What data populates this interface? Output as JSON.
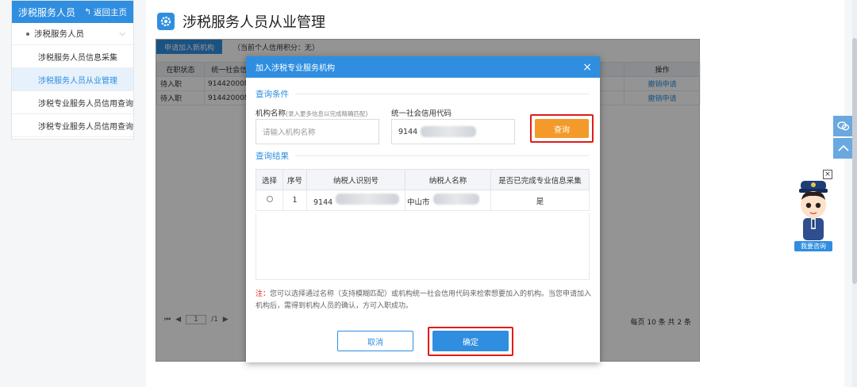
{
  "sidebar": {
    "title": "涉税服务人员",
    "back_label": "返回主页",
    "group_label": "涉税服务人员",
    "items": [
      {
        "label": "涉税服务人员信息采集",
        "active": false
      },
      {
        "label": "涉税服务人员从业管理",
        "active": true
      },
      {
        "label": "涉税专业服务人员信用查询",
        "active": false
      },
      {
        "label": "涉税专业服务人员信用查询",
        "active": false
      }
    ]
  },
  "main": {
    "page_title": "涉税服务人员从业管理",
    "apply_button": "申请加入新机构",
    "credit_text": "（当前个人信用积分：无）",
    "table": {
      "headers": [
        "在职状态",
        "统一社会信",
        "",
        "",
        "",
        "",
        "",
        "操作"
      ],
      "rows": [
        {
          "status": "待入职",
          "code": "91442000M",
          "action": "撤销申请"
        },
        {
          "status": "待入职",
          "code": "91442000M",
          "action": "撤销申请"
        }
      ]
    },
    "pager": {
      "first": "⏮",
      "prev": "◀",
      "page": "1",
      "total": "/1",
      "next": "▶",
      "summary": "每页 10 条 共 2 条"
    }
  },
  "modal": {
    "title": "加入涉税专业服务机构",
    "close": "×",
    "query_section": "查询条件",
    "org_name_label": "机构名称",
    "org_name_hint": "(录入更多信息以完成精确匹配)",
    "org_name_placeholder": "请输入机构名称",
    "credit_code_label": "统一社会信用代码",
    "credit_code_value": "9144",
    "query_button": "查询",
    "result_section": "查询结果",
    "result_headers": [
      "选择",
      "序号",
      "纳税人识别号",
      "纳税人名称",
      "是否已完成专业信息采集"
    ],
    "result_rows": [
      {
        "index": "1",
        "tax_id": "9144",
        "name": "中山市",
        "done": "是"
      }
    ],
    "note_prefix": "注：",
    "note_text": "您可以选择通过名称（支持模糊匹配）或机构统一社会信用代码来检索想要加入的机构。当您申请加入机构后，需得到机构人员的确认，方可入职成功。",
    "cancel_button": "取消",
    "ok_button": "确定"
  },
  "assistant": {
    "label": "我要咨询",
    "close": "×"
  },
  "colors": {
    "primary": "#2f8ee0",
    "orange": "#f39a2a",
    "highlight": "#e21b1b"
  }
}
